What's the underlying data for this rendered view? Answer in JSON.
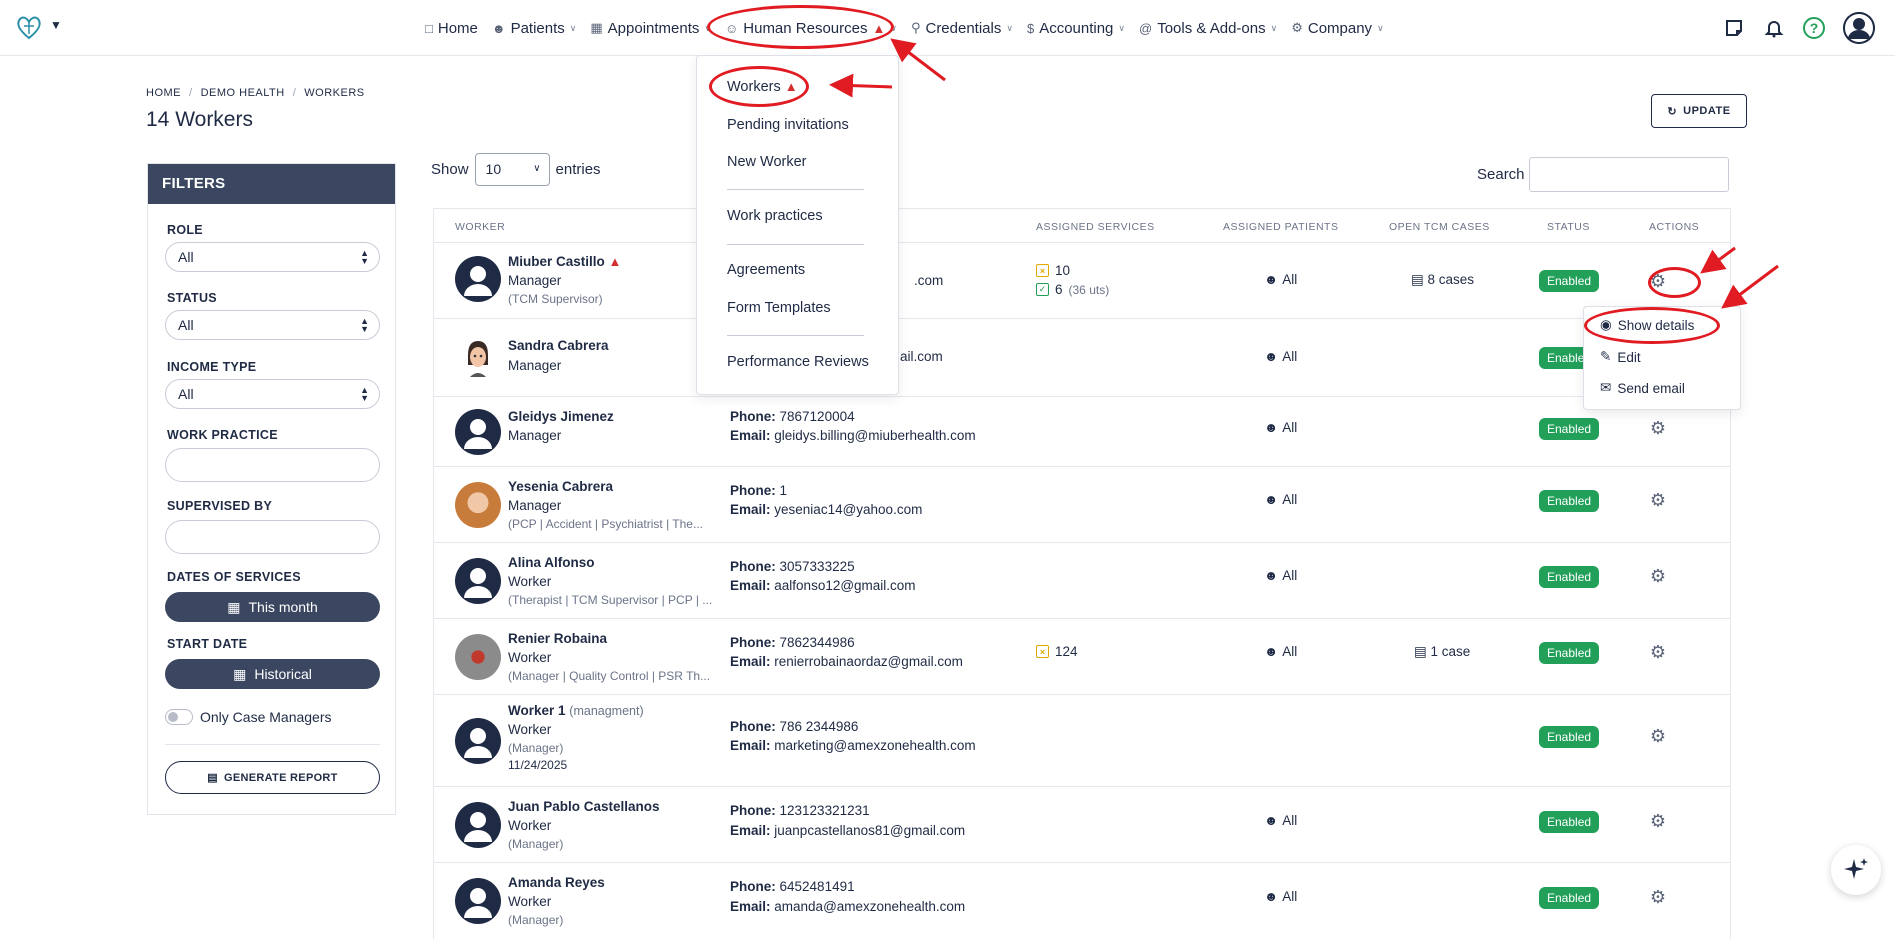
{
  "nav": {
    "items": [
      {
        "label": "Home",
        "icon": "monitor-icon",
        "caret": false
      },
      {
        "label": "Patients",
        "icon": "users-icon",
        "caret": true
      },
      {
        "label": "Appointments",
        "icon": "calendar-icon",
        "caret": true
      },
      {
        "label": "Human Resources",
        "icon": "user-plus-icon",
        "caret": true,
        "warning": true
      },
      {
        "label": "Credentials",
        "icon": "key-icon",
        "caret": true
      },
      {
        "label": "Accounting",
        "icon": "dollar-icon",
        "caret": true
      },
      {
        "label": "Tools & Add-ons",
        "icon": "at-icon",
        "caret": true
      },
      {
        "label": "Company",
        "icon": "gear-icon",
        "caret": true
      }
    ],
    "help": "?"
  },
  "breadcrumb": [
    "HOME",
    "DEMO HEALTH",
    "WORKERS"
  ],
  "page_title": "14 Workers",
  "update_label": "UPDATE",
  "filters": {
    "title": "FILTERS",
    "role_label": "ROLE",
    "role_value": "All",
    "status_label": "STATUS",
    "status_value": "All",
    "income_label": "INCOME TYPE",
    "income_value": "All",
    "work_practice_label": "WORK PRACTICE",
    "supervised_label": "SUPERVISED BY",
    "dates_label": "DATES OF SERVICES",
    "dates_value": "This month",
    "start_label": "START DATE",
    "start_value": "Historical",
    "only_cm_label": "Only Case Managers",
    "generate_label": "GENERATE REPORT"
  },
  "table_controls": {
    "show": "Show",
    "entries_value": "10",
    "entries": "entries",
    "search": "Search"
  },
  "columns": [
    "WORKER",
    "ASSIGNED SERVICES",
    "ASSIGNED PATIENTS",
    "OPEN TCM CASES",
    "STATUS",
    "ACTIONS"
  ],
  "rows": [
    {
      "name": "Miuber Castillo",
      "role": "Manager",
      "tags": "(TCM Supervisor)",
      "contact_frag": ".com",
      "svc1": "10",
      "svc2": "6",
      "svc2_note": "(36 uts)",
      "patients": "All",
      "cases": "8 cases",
      "status": "Enabled"
    },
    {
      "name": "Sandra Cabrera",
      "role": "Manager",
      "contact_frag": "ail.com",
      "patients": "All",
      "status": "Enabled"
    },
    {
      "name": "Gleidys Jimenez",
      "role": "Manager",
      "phone_label": "Phone:",
      "phone": "7867120004",
      "email_label": "Email:",
      "email": "gleidys.billing@miuberhealth.com",
      "patients": "All",
      "status": "Enabled"
    },
    {
      "name": "Yesenia Cabrera",
      "role": "Manager",
      "tags": "(PCP | Accident | Psychiatrist | The...",
      "phone_label": "Phone:",
      "phone": "1",
      "email_label": "Email:",
      "email": "yeseniac14@yahoo.com",
      "patients": "All",
      "status": "Enabled"
    },
    {
      "name": "Alina Alfonso",
      "role": "Worker",
      "tags": "(Therapist | TCM Supervisor | PCP | ...",
      "phone_label": "Phone:",
      "phone": "3057333225",
      "email_label": "Email:",
      "email": "aalfonso12@gmail.com",
      "patients": "All",
      "status": "Enabled"
    },
    {
      "name": "Renier Robaina",
      "role": "Worker",
      "tags": "(Manager | Quality Control | PSR Th...",
      "phone_label": "Phone:",
      "phone": "7862344986",
      "email_label": "Email:",
      "email": "renierrobainaordaz@gmail.com",
      "svc1": "124",
      "patients": "All",
      "cases": "1 case",
      "status": "Enabled"
    },
    {
      "name": "Worker 1",
      "name_sub": "(managment)",
      "role": "Worker",
      "tags": "(Manager)",
      "date": "11/24/2025",
      "phone_label": "Phone:",
      "phone": "786 2344986",
      "email_label": "Email:",
      "email": "marketing@amexzonehealth.com",
      "status": "Enabled"
    },
    {
      "name": "Juan Pablo Castellanos",
      "role": "Worker",
      "tags": "(Manager)",
      "phone_label": "Phone:",
      "phone": "123123321231",
      "email_label": "Email:",
      "email": "juanpcastellanos81@gmail.com",
      "patients": "All",
      "status": "Enabled"
    },
    {
      "name": "Amanda Reyes",
      "role": "Worker",
      "tags": "(Manager)",
      "phone_label": "Phone:",
      "phone": "6452481491",
      "email_label": "Email:",
      "email": "amanda@amexzonehealth.com",
      "patients": "All",
      "status": "Enabled"
    }
  ],
  "hr_menu": {
    "workers": "Workers",
    "pending": "Pending invitations",
    "new_worker": "New Worker",
    "work_practices": "Work practices",
    "agreements": "Agreements",
    "form_templates": "Form Templates",
    "performance": "Performance Reviews"
  },
  "actions_menu": {
    "show_details": "Show details",
    "edit": "Edit",
    "send_email": "Send email"
  },
  "colors": {
    "navy": "#1f2a44",
    "accent_green": "#22a05a",
    "warning_red": "#d32f2f",
    "annotation_red": "#e01b22"
  }
}
